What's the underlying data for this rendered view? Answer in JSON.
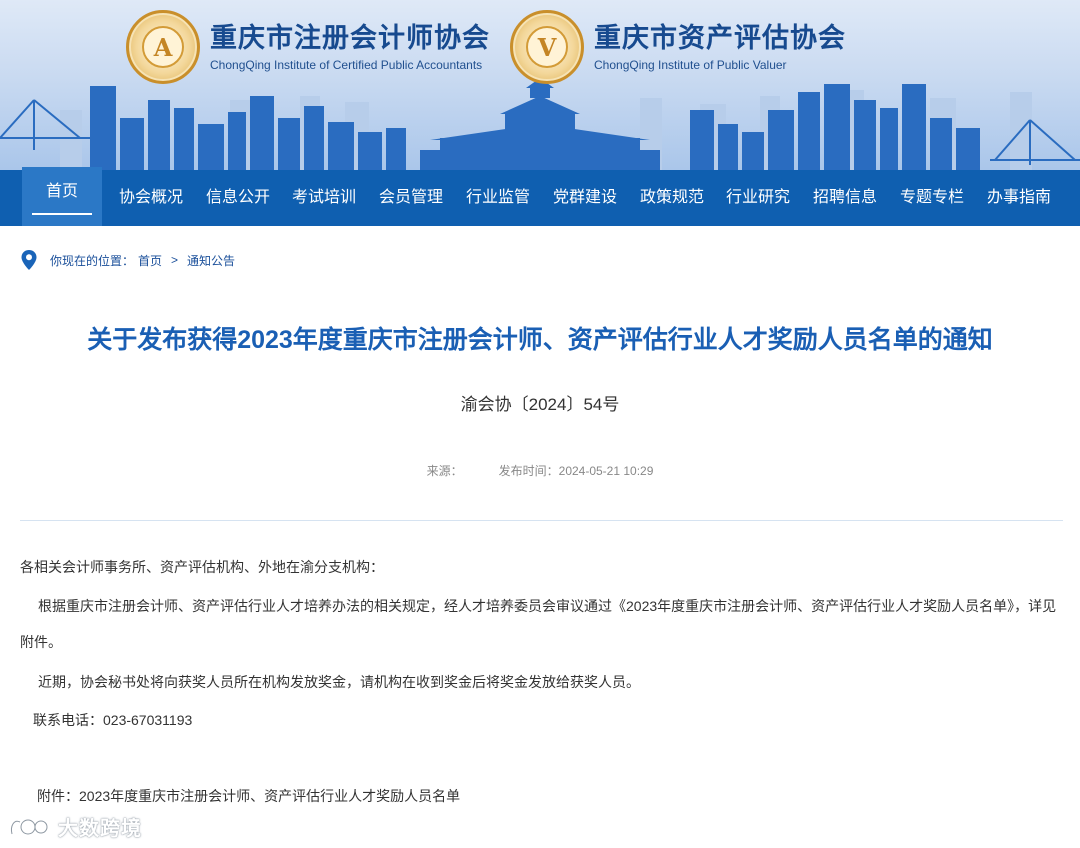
{
  "header": {
    "cpa": {
      "name_cn": "重庆市注册会计师协会",
      "name_en": "ChongQing Institute of Certified Public Accountants",
      "seal_letter": "A"
    },
    "valuer": {
      "name_cn": "重庆市资产评估协会",
      "name_en": "ChongQing Institute of Public Valuer",
      "seal_letter": "V"
    }
  },
  "nav": {
    "items": [
      "首页",
      "协会概况",
      "信息公开",
      "考试培训",
      "会员管理",
      "行业监管",
      "党群建设",
      "政策规范",
      "行业研究",
      "招聘信息",
      "专题专栏",
      "办事指南"
    ],
    "active_index": 0
  },
  "breadcrumb": {
    "label": "你现在的位置：",
    "home": "首页",
    "separator": ">",
    "current": "通知公告",
    "icon": "location-pin-icon"
  },
  "article": {
    "title": "关于发布获得2023年度重庆市注册会计师、资产评估行业人才奖励人员名单的通知",
    "doc_number": "渝会协〔2024〕54号",
    "source_label": "来源：",
    "publish_label": "发布时间：",
    "publish_time": "2024-05-21 10:29",
    "salutation": "各相关会计师事务所、资产评估机构、外地在渝分支机构：",
    "paragraph1": "根据重庆市注册会计师、资产评估行业人才培养办法的相关规定，经人才培养委员会审议通过《2023年度重庆市注册会计师、资产评估行业人才奖励人员名单》，详见附件。",
    "paragraph2": "近期，协会秘书处将向获奖人员所在机构发放奖金，请机构在收到奖金后将奖金发放给获奖人员。",
    "phone_label": "联系电话：",
    "phone": "023-67031193",
    "attachment_label": "附件：",
    "attachment_name": "2023年度重庆市注册会计师、资产评估行业人才奖励人员名单"
  },
  "watermark": {
    "text": "大数跨境"
  },
  "colors": {
    "nav_bg": "#0f5fb0",
    "nav_active": "#2b78c6",
    "title": "#1a5fb4",
    "banner_top": "#dfe9f7",
    "skyline": "#2a6cc0"
  }
}
